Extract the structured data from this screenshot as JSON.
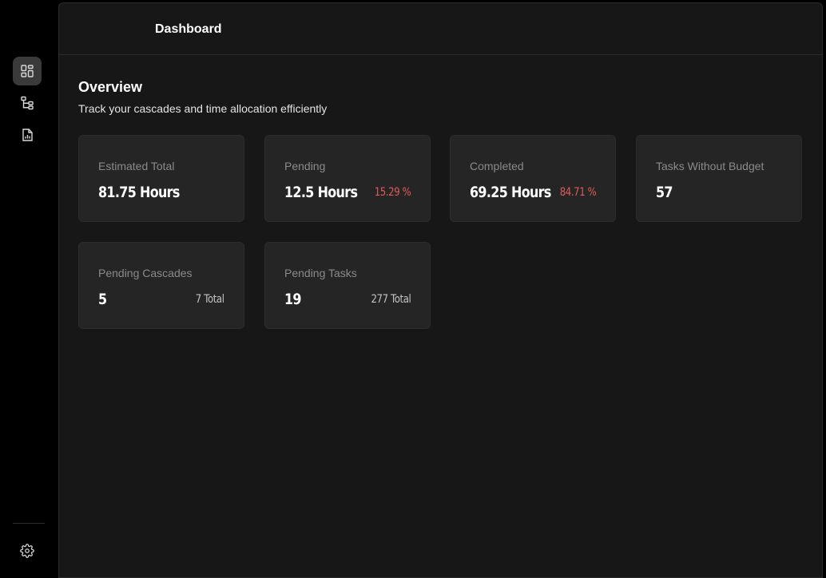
{
  "sidebar": {
    "items": [
      {
        "icon": "dashboard-icon",
        "active": true
      },
      {
        "icon": "cascade-tree-icon",
        "active": false
      },
      {
        "icon": "report-icon",
        "active": false
      }
    ],
    "footer_icon": "gear-icon"
  },
  "header": {
    "title": "Dashboard"
  },
  "overview": {
    "title": "Overview",
    "subtitle": "Track your cascades and time allocation efficiently"
  },
  "cards": [
    {
      "label": "Estimated Total",
      "value": "81.75 Hours",
      "sub": ""
    },
    {
      "label": "Pending",
      "value": "12.5 Hours",
      "sub": "15.29 %"
    },
    {
      "label": "Completed",
      "value": "69.25 Hours",
      "sub": "84.71 %"
    },
    {
      "label": "Tasks Without Budget",
      "value": "57",
      "sub": ""
    },
    {
      "label": "Pending Cascades",
      "value": "5",
      "sub": "7 Total"
    },
    {
      "label": "Pending Tasks",
      "value": "19",
      "sub": "277 Total"
    }
  ],
  "colors": {
    "background": "#000000",
    "panel": "#171717",
    "card": "#252525",
    "accent_red": "#e45a5a"
  }
}
